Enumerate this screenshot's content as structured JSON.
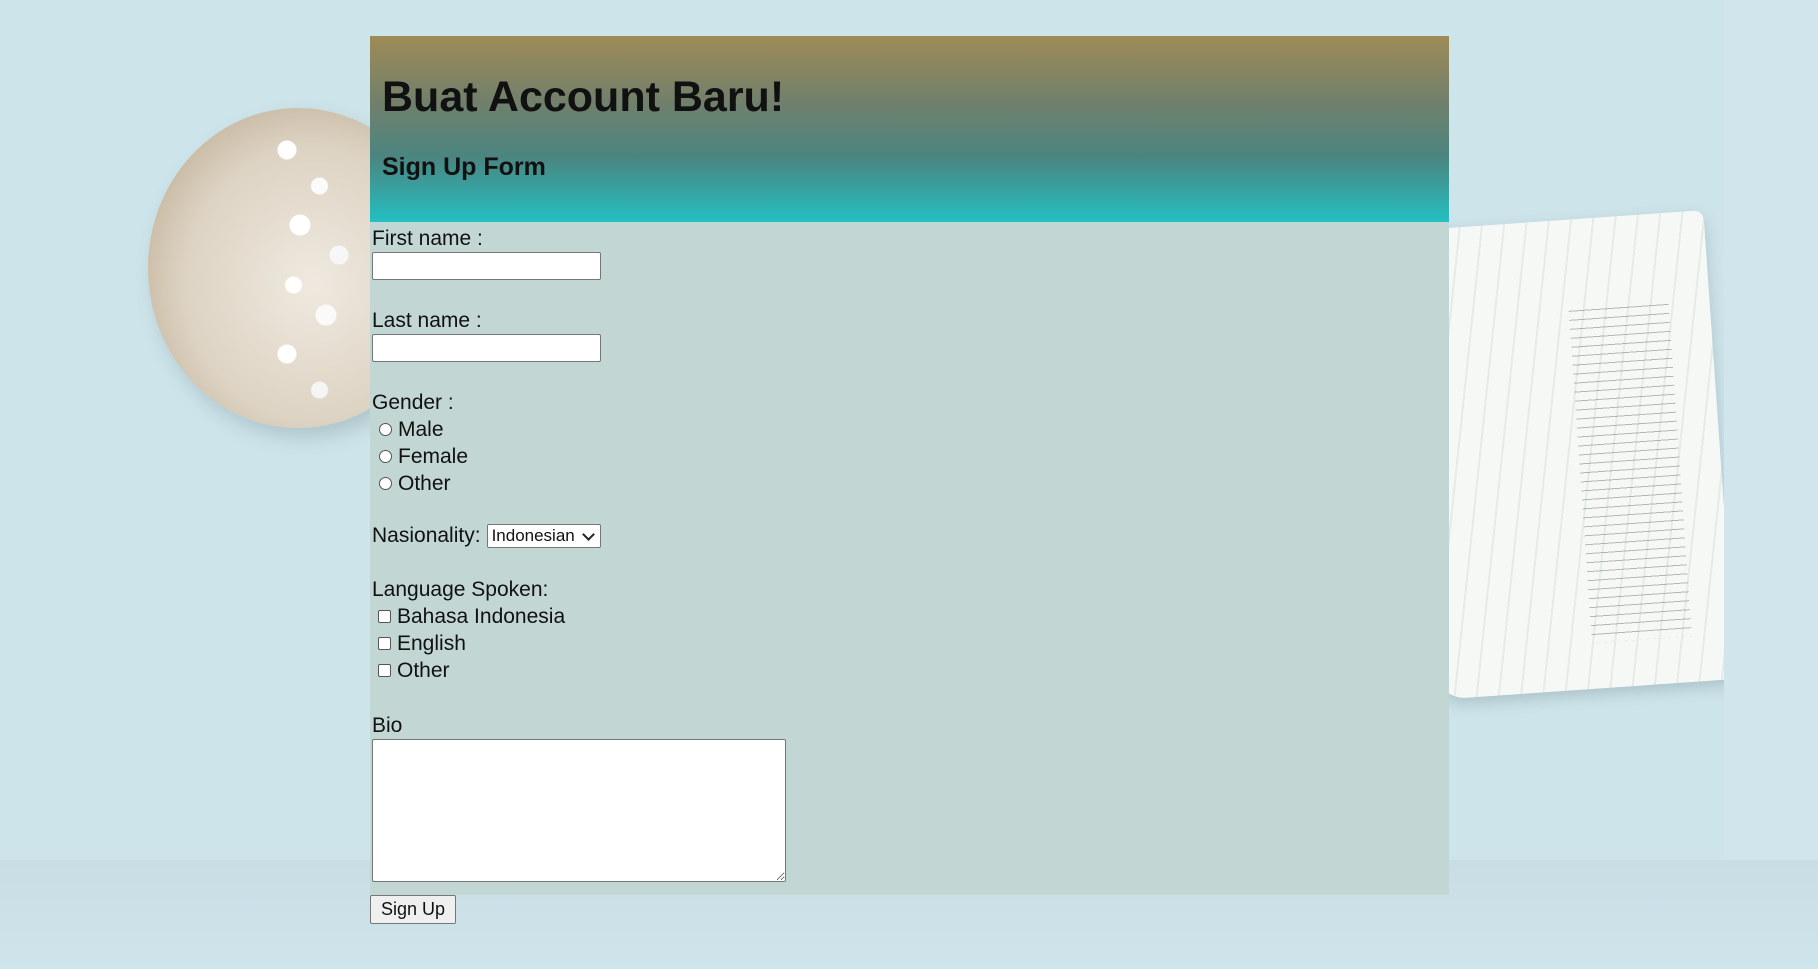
{
  "header": {
    "title": "Buat Account Baru!",
    "subtitle": "Sign Up Form"
  },
  "form": {
    "first_name_label": "First name :",
    "first_name_value": "",
    "last_name_label": "Last name :",
    "last_name_value": "",
    "gender_label": "Gender :",
    "gender_options": [
      "Male",
      "Female",
      "Other"
    ],
    "nationality_label": "Nasionality:",
    "nationality_selected": "Indonesian",
    "language_label": "Language Spoken:",
    "language_options": [
      "Bahasa Indonesia",
      "English",
      "Other"
    ],
    "bio_label": "Bio",
    "bio_value": "",
    "submit_label": "Sign Up"
  },
  "colors": {
    "header_top": "#9e8b57",
    "header_bottom": "#24bfc1",
    "form_background": "#c2d6d4",
    "page_background": "#cde4ea"
  },
  "icons": {
    "select_arrow": "chevron-down-icon"
  }
}
